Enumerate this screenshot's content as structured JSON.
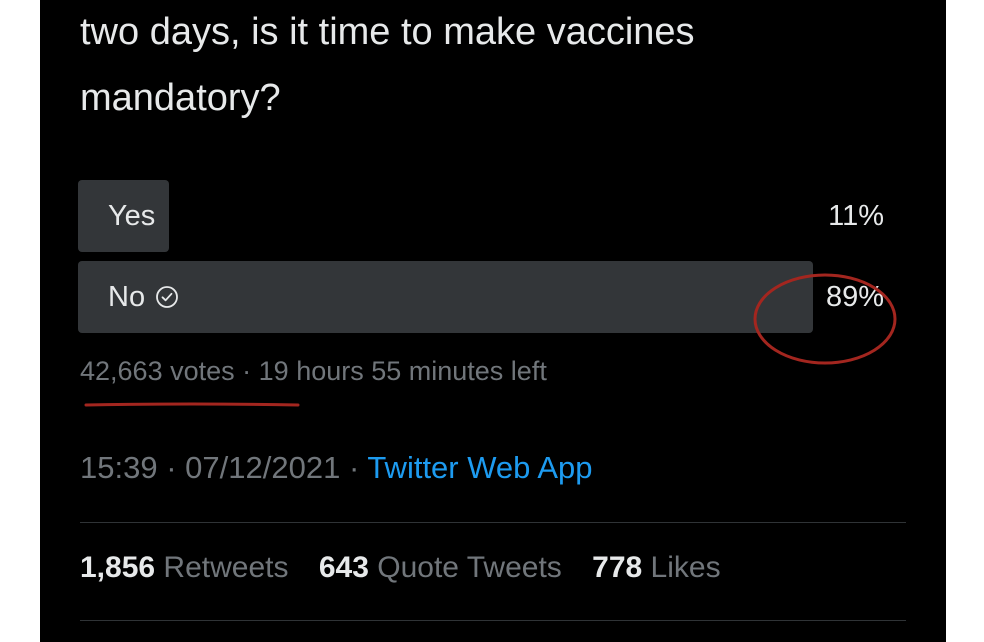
{
  "tweet": {
    "text_line1": "two days, is it time to make vaccines",
    "text_line2": "mandatory?"
  },
  "poll": {
    "options": [
      {
        "label": "Yes",
        "percent_label": "11%",
        "percent": 11,
        "selected": false
      },
      {
        "label": "No",
        "percent_label": "89%",
        "percent": 89,
        "selected": true
      }
    ],
    "votes": "42,663 votes",
    "separator": "·",
    "time_left": "19 hours 55 minutes left"
  },
  "meta": {
    "time": "15:39",
    "separator": "·",
    "date": "07/12/2021",
    "source": "Twitter Web App"
  },
  "stats": {
    "retweets_count": "1,856",
    "retweets_label": "Retweets",
    "quotes_count": "643",
    "quotes_label": "Quote Tweets",
    "likes_count": "778",
    "likes_label": "Likes"
  },
  "colors": {
    "background": "#000000",
    "text": "#e7e9ea",
    "muted": "#71767b",
    "bar": "#333639",
    "link": "#1d9bf0",
    "annotation": "#a3261f"
  },
  "icons": {
    "selected_vote": "check-circle-icon"
  }
}
